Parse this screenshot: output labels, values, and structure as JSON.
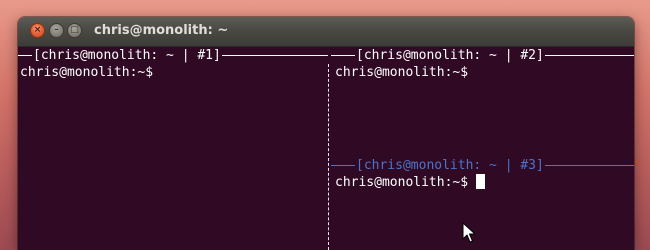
{
  "window": {
    "title": "chris@monolith: ~",
    "buttons": {
      "close_glyph": "×",
      "minimize_glyph": "–",
      "maximize_glyph": "□"
    }
  },
  "panes": [
    {
      "border_label": "[chris@monolith: ~ | #1]",
      "prompt": "chris@monolith:~$",
      "state": "inactive"
    },
    {
      "border_label": "[chris@monolith: ~ | #2]",
      "prompt": "chris@monolith:~$",
      "state": "inactive"
    },
    {
      "border_label": "[chris@monolith: ~ | #3]",
      "prompt": "chris@monolith:~$",
      "state": "active"
    }
  ],
  "colors": {
    "terminal_bg": "#300a24",
    "terminal_fg": "#ffffff",
    "active_border": "#4b74c9",
    "inactive_border": "#ffffff",
    "close_button": "#e8643b",
    "titlebar": "#3c3b37"
  },
  "icons": {
    "close": "close-icon",
    "minimize": "minimize-icon",
    "maximize": "maximize-icon",
    "pointer": "mouse-pointer-icon"
  }
}
